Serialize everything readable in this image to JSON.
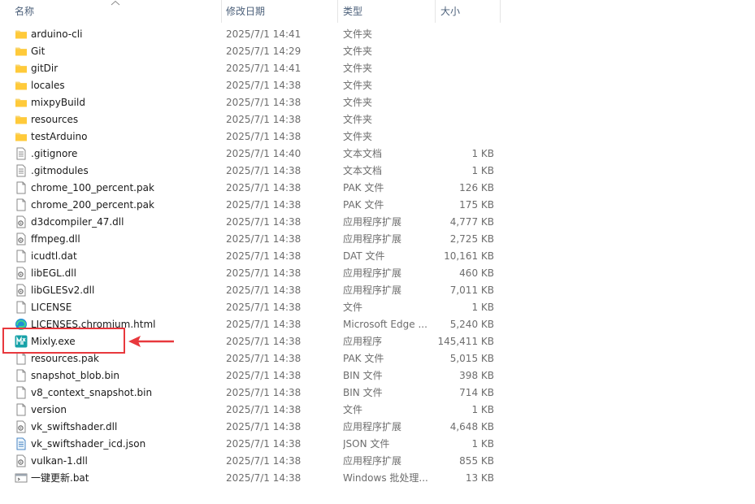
{
  "columns": {
    "name": "名称",
    "date": "修改日期",
    "type": "类型",
    "size": "大小"
  },
  "files": [
    {
      "name": "arduino-cli",
      "date": "2025/7/1 14:41",
      "type": "文件夹",
      "size": "",
      "icon": "folder-icon"
    },
    {
      "name": "Git",
      "date": "2025/7/1 14:29",
      "type": "文件夹",
      "size": "",
      "icon": "folder-icon"
    },
    {
      "name": "gitDir",
      "date": "2025/7/1 14:41",
      "type": "文件夹",
      "size": "",
      "icon": "folder-icon"
    },
    {
      "name": "locales",
      "date": "2025/7/1 14:38",
      "type": "文件夹",
      "size": "",
      "icon": "folder-icon"
    },
    {
      "name": "mixpyBuild",
      "date": "2025/7/1 14:38",
      "type": "文件夹",
      "size": "",
      "icon": "folder-icon"
    },
    {
      "name": "resources",
      "date": "2025/7/1 14:38",
      "type": "文件夹",
      "size": "",
      "icon": "folder-icon"
    },
    {
      "name": "testArduino",
      "date": "2025/7/1 14:38",
      "type": "文件夹",
      "size": "",
      "icon": "folder-icon"
    },
    {
      "name": ".gitignore",
      "date": "2025/7/1 14:40",
      "type": "文本文档",
      "size": "1 KB",
      "icon": "text-file-icon"
    },
    {
      "name": ".gitmodules",
      "date": "2025/7/1 14:38",
      "type": "文本文档",
      "size": "1 KB",
      "icon": "text-file-icon"
    },
    {
      "name": "chrome_100_percent.pak",
      "date": "2025/7/1 14:38",
      "type": "PAK 文件",
      "size": "126 KB",
      "icon": "blank-file-icon"
    },
    {
      "name": "chrome_200_percent.pak",
      "date": "2025/7/1 14:38",
      "type": "PAK 文件",
      "size": "175 KB",
      "icon": "blank-file-icon"
    },
    {
      "name": "d3dcompiler_47.dll",
      "date": "2025/7/1 14:38",
      "type": "应用程序扩展",
      "size": "4,777 KB",
      "icon": "dll-file-icon"
    },
    {
      "name": "ffmpeg.dll",
      "date": "2025/7/1 14:38",
      "type": "应用程序扩展",
      "size": "2,725 KB",
      "icon": "dll-file-icon"
    },
    {
      "name": "icudtl.dat",
      "date": "2025/7/1 14:38",
      "type": "DAT 文件",
      "size": "10,161 KB",
      "icon": "blank-file-icon"
    },
    {
      "name": "libEGL.dll",
      "date": "2025/7/1 14:38",
      "type": "应用程序扩展",
      "size": "460 KB",
      "icon": "dll-file-icon"
    },
    {
      "name": "libGLESv2.dll",
      "date": "2025/7/1 14:38",
      "type": "应用程序扩展",
      "size": "7,011 KB",
      "icon": "dll-file-icon"
    },
    {
      "name": "LICENSE",
      "date": "2025/7/1 14:38",
      "type": "文件",
      "size": "1 KB",
      "icon": "blank-file-icon"
    },
    {
      "name": "LICENSES.chromium.html",
      "date": "2025/7/1 14:38",
      "type": "Microsoft Edge ...",
      "size": "5,240 KB",
      "icon": "edge-html-icon"
    },
    {
      "name": "Mixly.exe",
      "date": "2025/7/1 14:38",
      "type": "应用程序",
      "size": "145,411 KB",
      "icon": "mixly-app-icon"
    },
    {
      "name": "resources.pak",
      "date": "2025/7/1 14:38",
      "type": "PAK 文件",
      "size": "5,015 KB",
      "icon": "blank-file-icon"
    },
    {
      "name": "snapshot_blob.bin",
      "date": "2025/7/1 14:38",
      "type": "BIN 文件",
      "size": "398 KB",
      "icon": "blank-file-icon"
    },
    {
      "name": "v8_context_snapshot.bin",
      "date": "2025/7/1 14:38",
      "type": "BIN 文件",
      "size": "714 KB",
      "icon": "blank-file-icon"
    },
    {
      "name": "version",
      "date": "2025/7/1 14:38",
      "type": "文件",
      "size": "1 KB",
      "icon": "blank-file-icon"
    },
    {
      "name": "vk_swiftshader.dll",
      "date": "2025/7/1 14:38",
      "type": "应用程序扩展",
      "size": "4,648 KB",
      "icon": "dll-file-icon"
    },
    {
      "name": "vk_swiftshader_icd.json",
      "date": "2025/7/1 14:38",
      "type": "JSON 文件",
      "size": "1 KB",
      "icon": "json-file-icon"
    },
    {
      "name": "vulkan-1.dll",
      "date": "2025/7/1 14:38",
      "type": "应用程序扩展",
      "size": "855 KB",
      "icon": "dll-file-icon"
    },
    {
      "name": "一键更新.bat",
      "date": "2025/7/1 14:38",
      "type": "Windows 批处理...",
      "size": "13 KB",
      "icon": "bat-file-icon"
    }
  ],
  "annotation": {
    "highlight_color": "#e8383d"
  }
}
